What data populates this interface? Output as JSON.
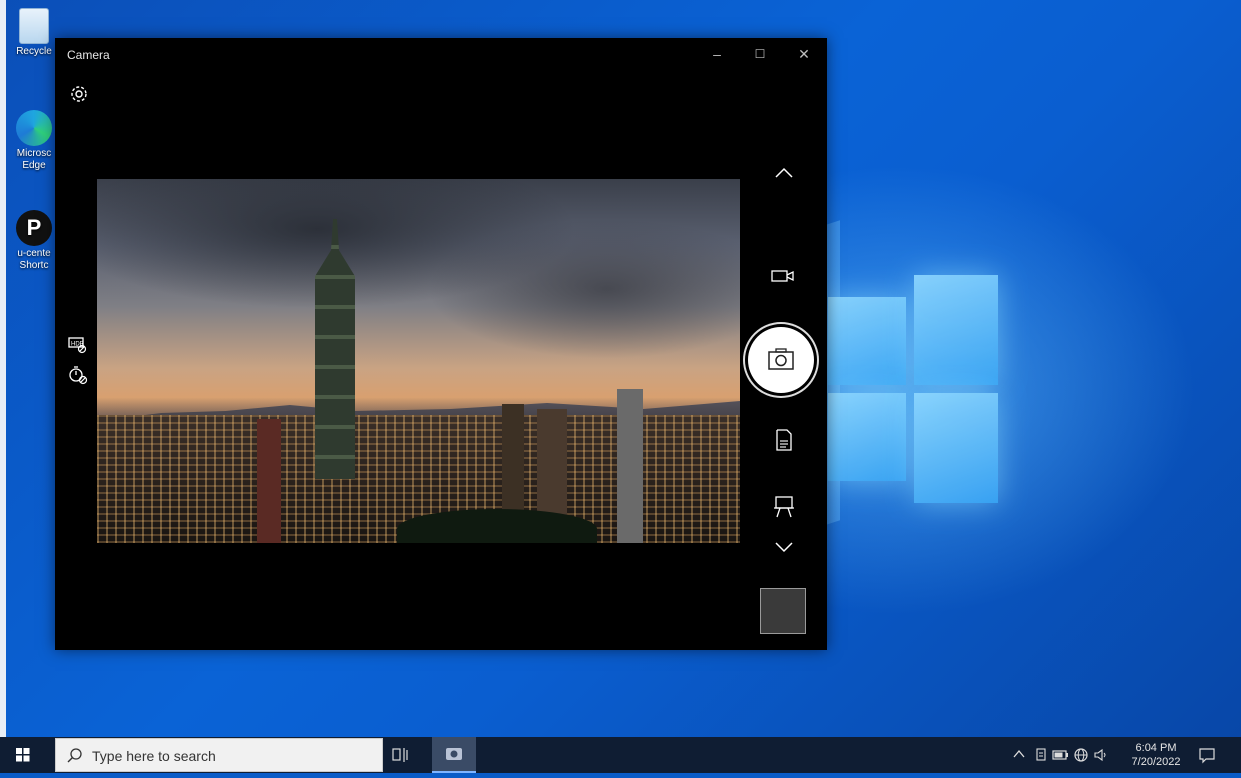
{
  "desktop": {
    "icons": [
      {
        "label": "Recycle"
      },
      {
        "label": "Microsc Edge"
      },
      {
        "label": "u-cente Shortc"
      }
    ]
  },
  "camera": {
    "title": "Camera",
    "controls": {
      "minimize": "–",
      "maximize": "☐",
      "close": "✕"
    }
  },
  "taskbar": {
    "search_placeholder": "Type here to search",
    "time": "6:04 PM",
    "date": "7/20/2022"
  }
}
